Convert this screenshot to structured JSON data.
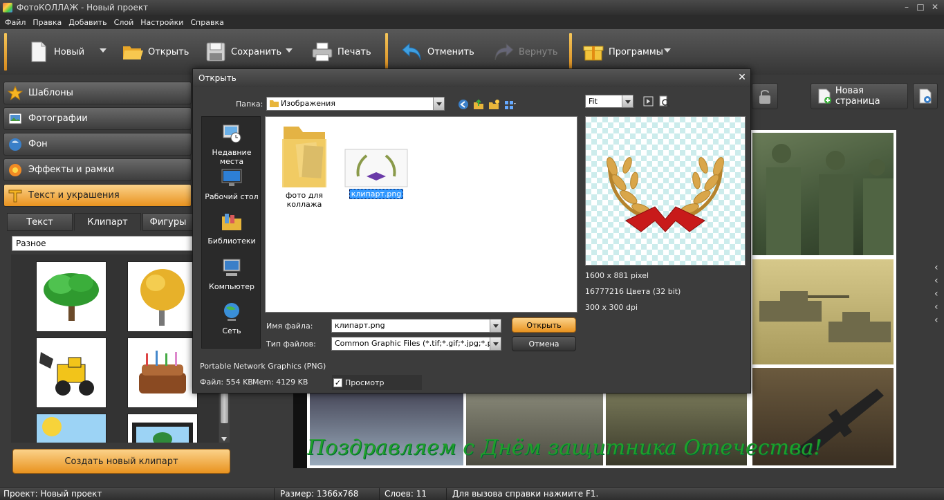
{
  "window": {
    "title": "ФотоКОЛЛАЖ - Новый проект",
    "controls": {
      "minimize": "–",
      "maximize": "□",
      "close": "✕"
    }
  },
  "menu": [
    "Файл",
    "Правка",
    "Добавить",
    "Слой",
    "Настройки",
    "Справка"
  ],
  "toolbar": {
    "new_label": "Новый",
    "open_label": "Открыть",
    "save_label": "Сохранить",
    "print_label": "Печать",
    "undo_label": "Отменить",
    "redo_label": "Вернуть",
    "programs_label": "Программы"
  },
  "sidebar": {
    "sections": [
      {
        "label": "Шаблоны",
        "icon": "star-icon"
      },
      {
        "label": "Фотографии",
        "icon": "photo-icon"
      },
      {
        "label": "Фон",
        "icon": "background-icon"
      },
      {
        "label": "Эффекты и рамки",
        "icon": "effects-icon"
      },
      {
        "label": "Текст и украшения",
        "icon": "text-icon"
      }
    ],
    "subtabs": [
      "Текст",
      "Клипарт",
      "Фигуры"
    ],
    "category_value": "Разное",
    "create_button": "Создать новый клипарт"
  },
  "workspace": {
    "new_page_label": "Новая страница",
    "greeting_text": "Поздравляем с Днём защитника Отечества!",
    "side_arrows": "‹"
  },
  "dialog": {
    "title": "Открыть",
    "close": "✕",
    "folder_label": "Папка:",
    "folder_value": "Изображения",
    "places": [
      {
        "label": "Недавние места",
        "icon": "recent-places-icon"
      },
      {
        "label": "Рабочий стол",
        "icon": "desktop-icon"
      },
      {
        "label": "Библиотеки",
        "icon": "libraries-icon"
      },
      {
        "label": "Компьютер",
        "icon": "computer-icon"
      },
      {
        "label": "Сеть",
        "icon": "network-icon"
      }
    ],
    "files": [
      {
        "name": "фото для коллажа",
        "type": "folder"
      },
      {
        "name": "клипарт.png",
        "type": "image",
        "selected": true
      }
    ],
    "preview_mode": "Fit",
    "image_info": {
      "dimensions": "1600 x 881 pixel",
      "colors": "16777216 Цвета (32 bit)",
      "dpi": "300 x 300 dpi"
    },
    "filename_label": "Имя файла:",
    "filename_value": "клипарт.png",
    "filetype_label": "Тип файлов:",
    "filetype_value": "Common Graphic Files (*.tif;*.gif;*.jpg;*.pcx;*",
    "open_button": "Открыть",
    "cancel_button": "Отмена",
    "format_text": "Portable Network Graphics (PNG)",
    "file_size": "Файл: 554 KB",
    "mem_size": "Mem: 4129 KB",
    "preview_check": "Просмотр"
  },
  "status": {
    "project": "Проект:  Новый проект",
    "size": "Размер:  1366x768",
    "layers": "Слоев:  11",
    "help": "Для вызова справки нажмите F1."
  },
  "colors": {
    "accent_orange": "#e9931f",
    "selection_blue": "#3399ff",
    "greeting_green": "#1fa02a"
  }
}
